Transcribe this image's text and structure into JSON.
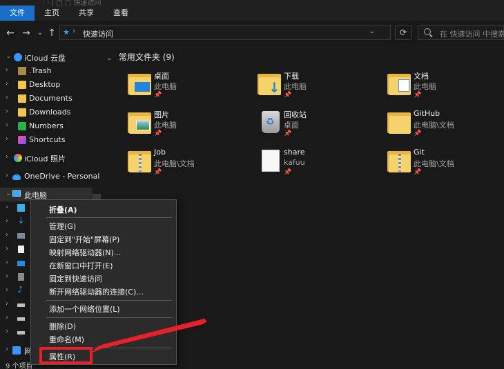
{
  "ribbon": {
    "ghost_title": "· · | ▢ ▢ 快速访问",
    "tabs": [
      {
        "label": "文件",
        "active": true
      },
      {
        "label": "主页",
        "active": false
      },
      {
        "label": "共享",
        "active": false
      },
      {
        "label": "查看",
        "active": false
      }
    ]
  },
  "nav": {
    "back": "←",
    "forward": "→",
    "recent": "⌄",
    "up": "↑",
    "breadcrumb_sep": "›",
    "breadcrumb": "快速访问",
    "dropdown": "⌄",
    "refresh": "⟳",
    "search_placeholder": "在 快速访问 中搜索"
  },
  "sidebar": {
    "items": [
      {
        "label": "iCloud 云盘",
        "icon": "icloud-icon",
        "expanded": true
      },
      {
        "label": ".Trash",
        "icon": "folder-icon"
      },
      {
        "label": "Desktop",
        "icon": "folder-icon"
      },
      {
        "label": "Documents",
        "icon": "folder-icon"
      },
      {
        "label": "Downloads",
        "icon": "folder-icon"
      },
      {
        "label": "Numbers",
        "icon": "numbers-app-icon"
      },
      {
        "label": "Shortcuts",
        "icon": "shortcuts-app-icon"
      },
      {
        "label": "iCloud 照片",
        "icon": "icloud-photos-icon"
      },
      {
        "label": "OneDrive - Personal",
        "icon": "onedrive-icon"
      },
      {
        "label": "此电脑",
        "icon": "this-pc-icon",
        "selected": true
      },
      {
        "label": "网络",
        "icon": "network-icon"
      }
    ]
  },
  "main": {
    "group_title": "常用文件夹 (9)",
    "tiles": [
      {
        "name": "桌面",
        "location": "此电脑",
        "icon": "desktop-folder-icon"
      },
      {
        "name": "下载",
        "location": "此电脑",
        "icon": "downloads-folder-icon"
      },
      {
        "name": "文档",
        "location": "此电脑",
        "icon": "documents-folder-icon"
      },
      {
        "name": "图片",
        "location": "此电脑",
        "icon": "pictures-folder-icon"
      },
      {
        "name": "回收站",
        "location": "桌面",
        "icon": "recycle-bin-icon"
      },
      {
        "name": "GitHub",
        "location": "此电脑\\文档",
        "icon": "folder-icon"
      },
      {
        "name": "Job",
        "location": "此电脑\\文档",
        "icon": "zip-folder-icon"
      },
      {
        "name": "share",
        "location": "kafuu",
        "icon": "share-folder-icon"
      },
      {
        "name": "Git",
        "location": "此电脑\\文档",
        "icon": "zip-folder-icon"
      }
    ],
    "pin_glyph": "📌"
  },
  "status": {
    "text": "9 个项目"
  },
  "context_menu": {
    "items": [
      {
        "label": "折叠(A)",
        "bold": true
      },
      {
        "label": "管理(G)"
      },
      {
        "label": "固定到\"开始\"屏幕(P)"
      },
      {
        "label": "映射网络驱动器(N)..."
      },
      {
        "label": "在新窗口中打开(E)"
      },
      {
        "label": "固定到快速访问"
      },
      {
        "label": "断开网络驱动器的连接(C)..."
      },
      {
        "label": "添加一个网络位置(L)"
      },
      {
        "label": "删除(D)"
      },
      {
        "label": "重命名(M)"
      },
      {
        "label": "属性(R)"
      }
    ]
  },
  "colors": {
    "accent": "#1a6fc9",
    "highlight_box": "#e8202a"
  }
}
